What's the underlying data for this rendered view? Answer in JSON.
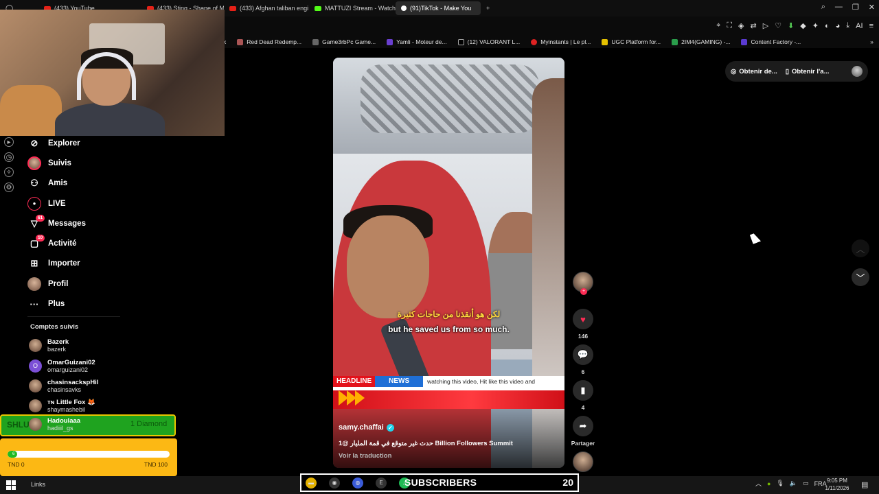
{
  "browser": {
    "tabs": [
      {
        "label": "(433) YouTube",
        "icon": "youtube-icon"
      },
      {
        "label": "(433) Sting - Shape of My",
        "icon": "youtube-icon"
      },
      {
        "label": "(433) Afghan taliban engi",
        "icon": "youtube-icon"
      },
      {
        "label": "MATTUZI Stream - Watch",
        "icon": "kick-icon"
      },
      {
        "label": "(91)TikTok - Make You",
        "icon": "tiktok-icon",
        "active": true
      }
    ],
    "new_tab": "+",
    "bookmarks": [
      {
        "label": "k"
      },
      {
        "label": "Red Dead Redemp..."
      },
      {
        "label": "Game3rbPc Game..."
      },
      {
        "label": "Yamli - Moteur de..."
      },
      {
        "label": "(12) VALORANT L..."
      },
      {
        "label": "Myinstants | Le pl..."
      },
      {
        "label": "UGC Platform for..."
      },
      {
        "label": "2IM4(GAMING) -..."
      },
      {
        "label": "Content Factory -..."
      }
    ],
    "ai_label": "AI"
  },
  "nav": {
    "items": [
      {
        "label": "Explorer",
        "icon": "compass-icon"
      },
      {
        "label": "Suivis",
        "icon": "avatar"
      },
      {
        "label": "Amis",
        "icon": "friends-icon"
      },
      {
        "label": "LIVE",
        "icon": "live-icon"
      },
      {
        "label": "Messages",
        "icon": "messages-icon",
        "badge": "61"
      },
      {
        "label": "Activité",
        "icon": "activity-icon",
        "badge": "10"
      },
      {
        "label": "Importer",
        "icon": "upload-icon"
      },
      {
        "label": "Profil",
        "icon": "avatar"
      },
      {
        "label": "Plus",
        "icon": "more-icon"
      }
    ]
  },
  "followed": {
    "title": "Comptes suivis",
    "accounts": [
      {
        "name": "Bazerk",
        "user": "bazerk",
        "initial": ""
      },
      {
        "name": "OmarGuizani02",
        "user": "omarguizani02",
        "initial": "O"
      },
      {
        "name": "chasinsackspHil",
        "user": "chasinsavks",
        "initial": ""
      },
      {
        "name": "ᴛɴ Little Fox 🦊",
        "user": "shaymashebil",
        "initial": ""
      },
      {
        "name": "Hadoulaaa",
        "user": "hadiiil_gs",
        "initial": ""
      }
    ]
  },
  "donation": {
    "donor": "SHLUT",
    "amount": "1 Diamond"
  },
  "goal": {
    "min_label": "TND 0",
    "max_label": "TND 100",
    "progress": 0.06,
    "fill_label": "6"
  },
  "video": {
    "subtitle_ar": "لكن هو أنقذنا من حاجات كثيرة",
    "subtitle_en": "but he saved us from so much.",
    "ticker": {
      "headline": "HEADLINE",
      "news": "NEWS",
      "text": "watching this video, Hit like this video and"
    },
    "author": "samy.chaffai",
    "description": "حدث غير متوقع في قمة المليار @1 Billion Followers Summit",
    "translate": "Voir la traduction"
  },
  "actions": {
    "likes": "146",
    "comments": "6",
    "saves": "4",
    "share_label": "Partager"
  },
  "top_pills": {
    "left": "Obtenir de...",
    "right": "Obtenir l'a..."
  },
  "subscribers": {
    "label": "SUBSCRIBERS",
    "count": "20"
  },
  "taskbar": {
    "links": "Links",
    "lang": "FRA",
    "time": "9:05 PM",
    "date": "1/11/2026"
  },
  "colors": {
    "tiktok_red": "#fe2c55",
    "donation_green": "#1fa31f",
    "goal_yellow": "#fcb814"
  }
}
